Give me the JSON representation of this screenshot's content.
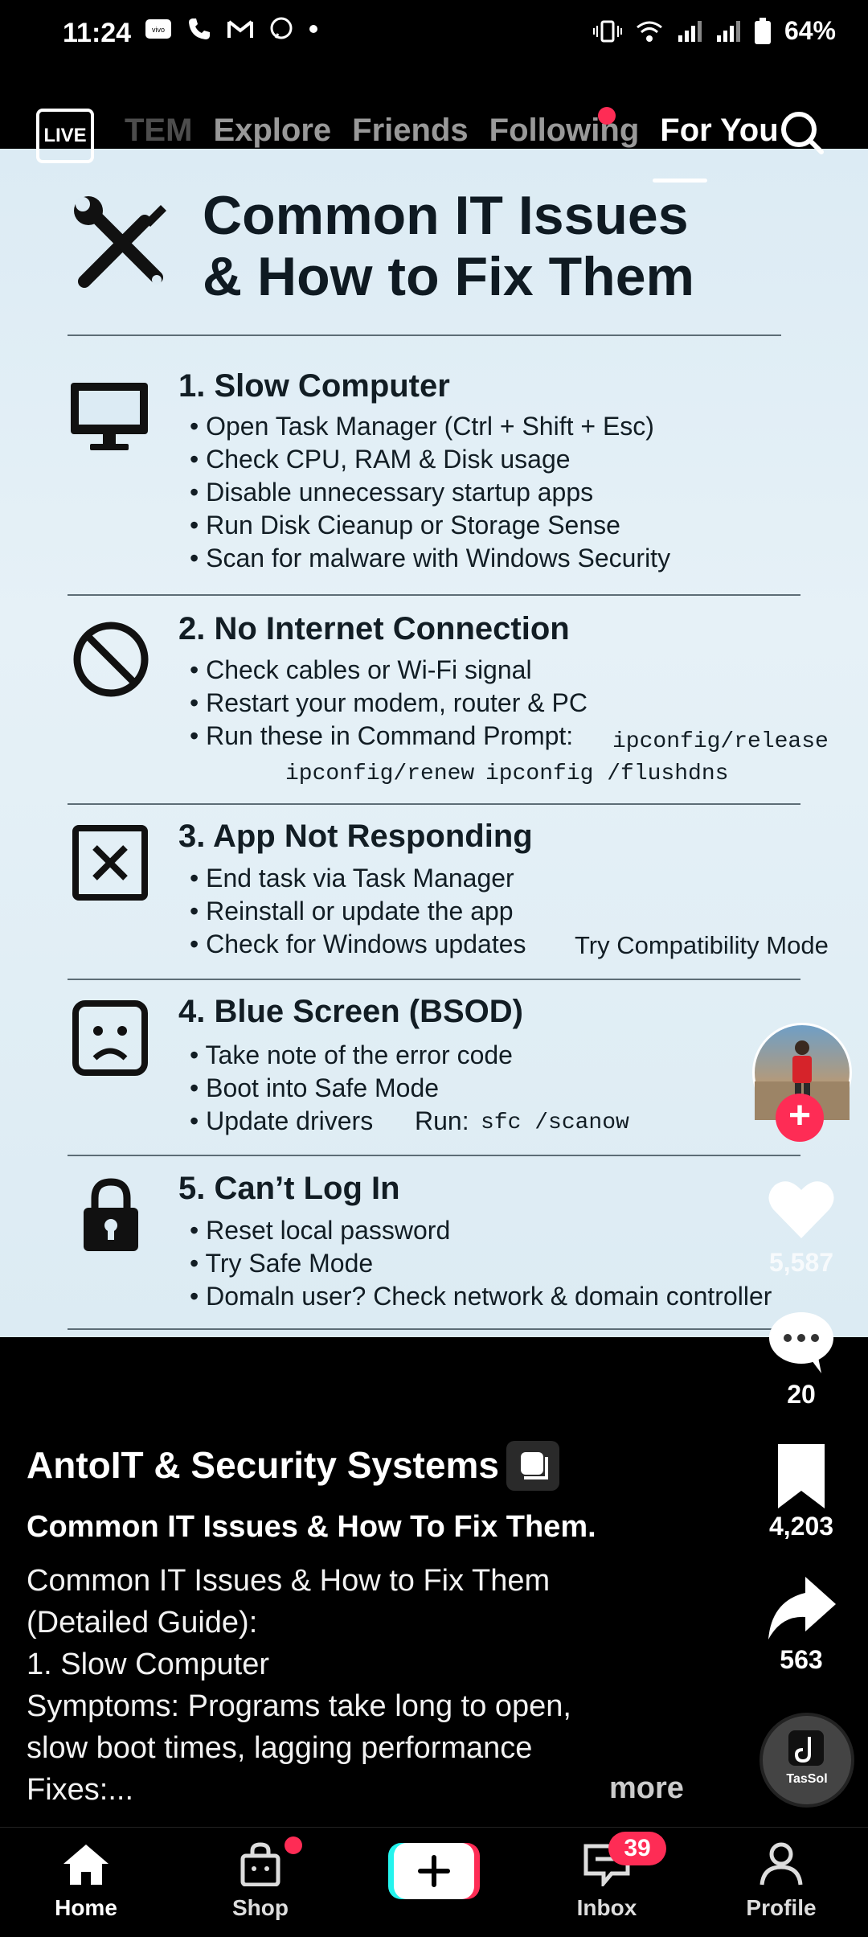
{
  "status_bar": {
    "time": "11:24",
    "battery": "64%",
    "icons_left": [
      "vivo-icon",
      "phone-icon",
      "gmail-icon",
      "viber-icon",
      "dot-icon"
    ],
    "icons_right": [
      "vibrate-icon",
      "wifi-icon",
      "signal-icon",
      "signal-icon",
      "battery-icon"
    ]
  },
  "top_nav": {
    "live_label": "LIVE",
    "tabs": [
      "TEM",
      "Explore",
      "Friends",
      "Following",
      "For You"
    ],
    "active_tab": "For You"
  },
  "infographic": {
    "title_line1": "Common IT Issues",
    "title_line2": "& How to Fix Them",
    "sections": [
      {
        "title": "1. Slow Computer",
        "icon": "monitor-icon",
        "bullets": [
          "Open Task Manager (Ctrl + Shift + Esc)",
          "Check CPU, RAM & Disk usage",
          "Disable unnecessary startup apps",
          "Run Disk Cieanup or Storage Sense",
          "Scan for malware with Windows Security"
        ]
      },
      {
        "title": "2. No Internet Connection",
        "icon": "no-entry-icon",
        "bullets": [
          "Check cables or Wi-Fi signal",
          "Restart your modem, router & PC",
          "Run these in Command Prompt:"
        ],
        "commands": [
          "ipconfig/release",
          "ipconfig/renew",
          "ipconfig /flushdns"
        ]
      },
      {
        "title": "3. App Not Responding",
        "icon": "x-box-icon",
        "bullets": [
          "End task via Task Manager",
          "Reinstall or update the app",
          "Check for Windows updates"
        ],
        "extra": "Try Compatibility Mode"
      },
      {
        "title": "4. Blue Screen (BSOD)",
        "icon": "sad-face-icon",
        "bullets": [
          "Take note of the error code",
          "Boot into Safe Mode",
          "Update drivers"
        ],
        "run_label": "Run:",
        "run_command": "sfc /scanow"
      },
      {
        "title": "5. Can’t Log In",
        "icon": "lock-icon",
        "bullets": [
          "Reset local password",
          "Try Safe Mode",
          "Domaln user? Check network & domain controller"
        ]
      }
    ]
  },
  "right_rail": {
    "likes": "5,587",
    "comments": "20",
    "saves": "4,203",
    "shares": "563",
    "sound_label": "TasSol"
  },
  "caption": {
    "author": "AntoIT & Security Systems",
    "title": "Common IT Issues & How To Fix Them.",
    "body_lines": [
      "Common IT Issues & How to Fix Them",
      "(Detailed Guide):",
      "1. Slow Computer",
      "Symptoms: Programs take long to open,",
      "slow boot times, lagging performance",
      "Fixes:..."
    ],
    "more": "more"
  },
  "bottom_nav": {
    "items": [
      "Home",
      "Shop",
      "",
      "Inbox",
      "Profile"
    ],
    "inbox_badge": "39"
  }
}
